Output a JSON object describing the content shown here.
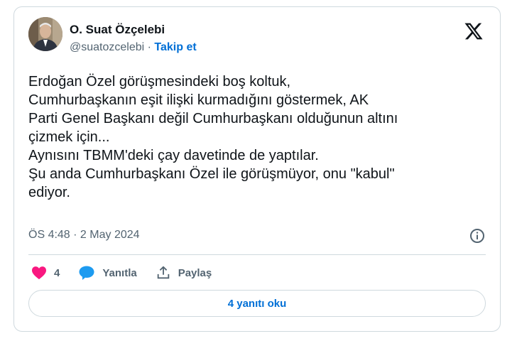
{
  "author": {
    "name": "O. Suat Özçelebi",
    "handle": "@suatozcelebi",
    "separator": "·",
    "follow_label": "Takip et"
  },
  "tweet": {
    "text": "Erdoğan Özel görüşmesindeki boş koltuk,\nCumhurbaşkanın eşit ilişki kurmadığını göstermek, AK\nParti Genel Başkanı değil Cumhurbaşkanı olduğunun altını\nçizmek için...\nAynısını TBMM'deki çay davetinde de yaptılar.\nŞu anda Cumhurbaşkanı Özel ile görüşmüyor, onu \"kabul\"\nediyor.",
    "timestamp": "ÖS 4:48 · 2 May 2024"
  },
  "actions": {
    "like_count": "4",
    "reply_label": "Yanıtla",
    "share_label": "Paylaş"
  },
  "read_replies_label": "4 yanıtı oku",
  "colors": {
    "accent": "#1d9bf0",
    "link": "#006fd6",
    "like": "#f91880",
    "muted": "#536471",
    "border": "#cfd9de"
  },
  "icons": [
    "x-logo-icon",
    "info-icon",
    "heart-icon",
    "reply-bubble-icon",
    "share-icon"
  ]
}
